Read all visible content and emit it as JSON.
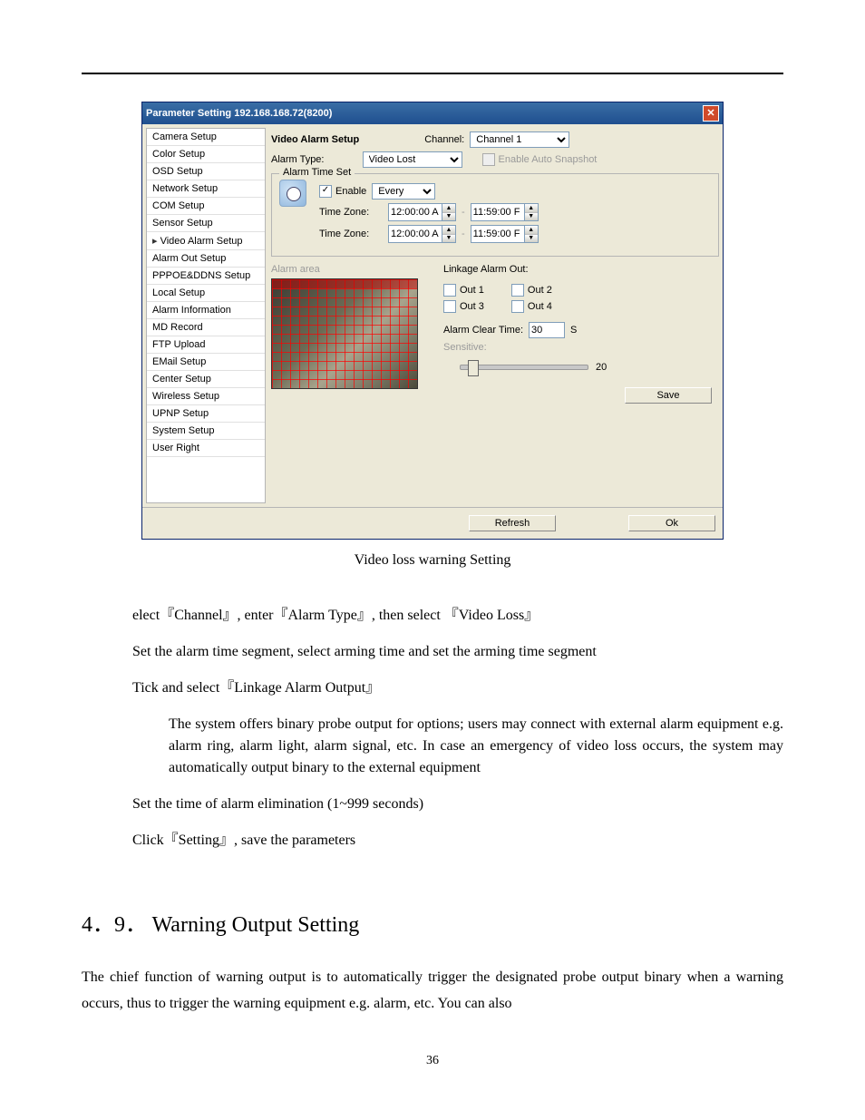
{
  "dialog": {
    "title": "Parameter Setting 192.168.168.72(8200)",
    "sidebar": [
      "Camera Setup",
      "Color Setup",
      "OSD Setup",
      "Network Setup",
      "COM Setup",
      "Sensor Setup",
      "Video Alarm Setup",
      "Alarm Out Setup",
      "PPPOE&DDNS Setup",
      "Local Setup",
      "Alarm Information",
      "MD Record",
      "FTP Upload",
      "EMail Setup",
      "Center Setup",
      "Wireless Setup",
      "UPNP Setup",
      "System Setup",
      "User Right"
    ],
    "active_index": 6,
    "header": {
      "title": "Video Alarm Setup",
      "channel_label": "Channel:",
      "channel_value": "Channel 1"
    },
    "alarm_type": {
      "label": "Alarm Type:",
      "value": "Video Lost",
      "snapshot_label": "Enable Auto Snapshot"
    },
    "time_set": {
      "legend": "Alarm Time Set",
      "enable_label": "Enable",
      "every_value": "Every",
      "tz_label": "Time Zone:",
      "t1_from": "12:00:00 A",
      "t1_to": "11:59:00 F",
      "t2_from": "12:00:00 A",
      "t2_to": "11:59:00 F",
      "dash": "-"
    },
    "alarm_area_label": "Alarm area",
    "linkage": {
      "title": "Linkage Alarm Out:",
      "outs": [
        "Out 1",
        "Out 2",
        "Out 3",
        "Out 4"
      ],
      "clear_label": "Alarm Clear Time:",
      "clear_value": "30",
      "clear_unit": "S",
      "sensitive_label": "Sensitive:",
      "sensitive_value": "20",
      "save": "Save"
    },
    "bottom": {
      "refresh": "Refresh",
      "ok": "Ok"
    }
  },
  "caption": "Video loss warning Setting",
  "text": {
    "l1": "elect『Channel』, enter『Alarm Type』, then select 『Video Loss』",
    "l2": "Set the alarm time segment, select arming time and set the arming time segment",
    "l3": "Tick and select『Linkage Alarm Output』",
    "l4": "The system offers binary probe output for options; users may connect with external alarm equipment e.g. alarm ring, alarm light, alarm signal, etc. In case an emergency of video loss occurs, the system may automatically output binary to the external equipment",
    "l5": "Set the time of alarm elimination (1~999 seconds)",
    "l6": "Click『Setting』, save the parameters"
  },
  "section": {
    "num": "4．9．",
    "title": "Warning Output Setting"
  },
  "body": "The chief function of warning output is to automatically trigger the designated probe output binary when a warning occurs, thus to trigger the warning equipment e.g. alarm, etc. You can also",
  "pagenum": "36"
}
